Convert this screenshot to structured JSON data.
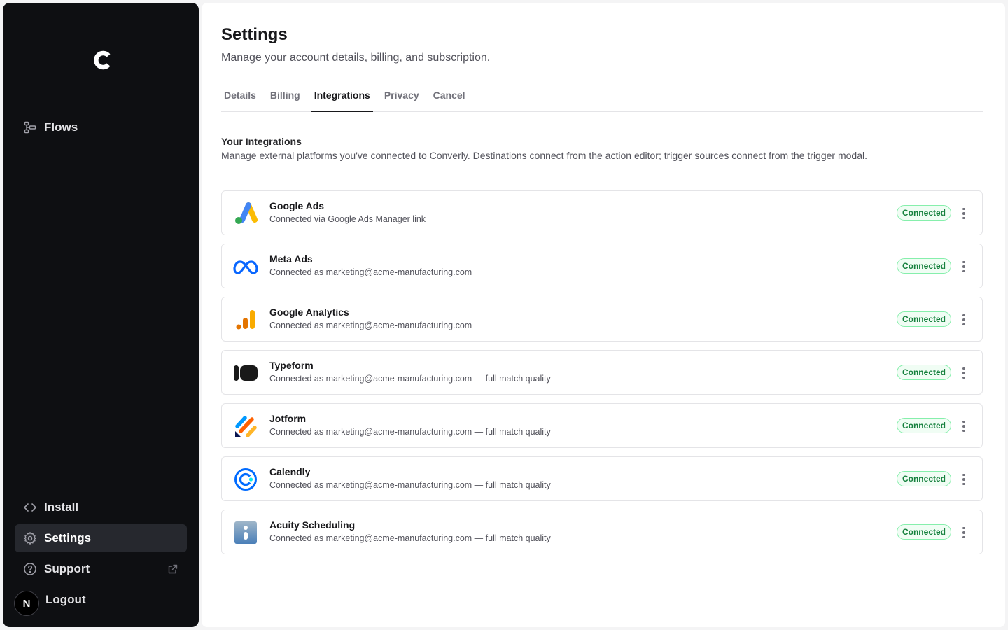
{
  "sidebar": {
    "logo_icon": "converly-c-logo",
    "top_items": [
      {
        "label": "Flows",
        "icon": "flows-icon"
      }
    ],
    "bottom_items": [
      {
        "label": "Install",
        "icon": "code-icon"
      },
      {
        "label": "Settings",
        "icon": "gear-icon",
        "active": true
      },
      {
        "label": "Support",
        "icon": "help-circle-icon",
        "external": true
      }
    ],
    "logout": {
      "label": "Logout",
      "avatar_initial": "N"
    }
  },
  "header": {
    "title": "Settings",
    "subtitle": "Manage your account details, billing, and subscription."
  },
  "tabs": [
    {
      "label": "Details"
    },
    {
      "label": "Billing"
    },
    {
      "label": "Integrations",
      "active": true
    },
    {
      "label": "Privacy"
    },
    {
      "label": "Cancel"
    }
  ],
  "integrations_section": {
    "title": "Your Integrations",
    "description": "Manage external platforms you've connected to Converly. Destinations connect from the action editor; trigger sources connect from the trigger modal."
  },
  "integrations": [
    {
      "name": "Google Ads",
      "detail": "Connected via Google Ads Manager link",
      "status": "Connected",
      "icon": "google-ads-icon"
    },
    {
      "name": "Meta Ads",
      "detail": "Connected as marketing@acme-manufacturing.com",
      "status": "Connected",
      "icon": "meta-icon"
    },
    {
      "name": "Google Analytics",
      "detail": "Connected as marketing@acme-manufacturing.com",
      "status": "Connected",
      "icon": "google-analytics-icon"
    },
    {
      "name": "Typeform",
      "detail": "Connected as marketing@acme-manufacturing.com — full match quality",
      "status": "Connected",
      "icon": "typeform-icon"
    },
    {
      "name": "Jotform",
      "detail": "Connected as marketing@acme-manufacturing.com — full match quality",
      "status": "Connected",
      "icon": "jotform-icon"
    },
    {
      "name": "Calendly",
      "detail": "Connected as marketing@acme-manufacturing.com — full match quality",
      "status": "Connected",
      "icon": "calendly-icon"
    },
    {
      "name": "Acuity Scheduling",
      "detail": "Connected as marketing@acme-manufacturing.com — full match quality",
      "status": "Connected",
      "icon": "acuity-icon"
    }
  ],
  "colors": {
    "sidebar_bg": "#0e0f12",
    "active_nav_bg": "#26282e",
    "badge_text": "#15803d",
    "badge_bg": "#f0fdf4",
    "badge_border": "#86efac"
  }
}
